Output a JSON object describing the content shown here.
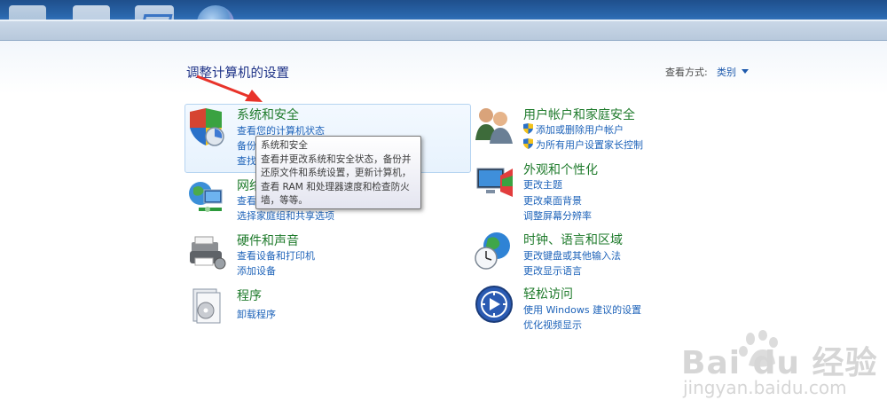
{
  "page": {
    "title": "调整计算机的设置",
    "view_by_label": "查看方式:",
    "view_by_value": "类别"
  },
  "categories": {
    "system_security": {
      "title": "系统和安全",
      "links": [
        "查看您的计算机状态",
        "备份",
        "查找"
      ]
    },
    "network": {
      "title": "网络",
      "links": [
        "查看",
        "选择家庭组和共享选项"
      ]
    },
    "hardware_sound": {
      "title": "硬件和声音",
      "links": [
        "查看设备和打印机",
        "添加设备"
      ]
    },
    "programs": {
      "title": "程序",
      "links": [
        "卸载程序"
      ]
    },
    "user_accounts": {
      "title": "用户帐户和家庭安全",
      "links": [
        "添加或删除用户帐户",
        "为所有用户设置家长控制"
      ]
    },
    "appearance": {
      "title": "外观和个性化",
      "links": [
        "更改主题",
        "更改桌面背景",
        "调整屏幕分辨率"
      ]
    },
    "clock_region": {
      "title": "时钟、语言和区域",
      "links": [
        "更改键盘或其他输入法",
        "更改显示语言"
      ]
    },
    "ease_access": {
      "title": "轻松访问",
      "links": [
        "使用 Windows 建议的设置",
        "优化视频显示"
      ]
    }
  },
  "tooltip": {
    "lines": [
      "系统和安全",
      "查看并更改系统和安全状态，备份并",
      "还原文件和系统设置，更新计算机，",
      "查看 RAM 和处理器速度和检查防火",
      "墙，等等。"
    ]
  },
  "watermark": {
    "brand": "Bai du 经验",
    "url": "jingyan.baidu.com"
  },
  "colors": {
    "category_title": "#1f7b2c",
    "link": "#1e63b9",
    "page_title": "#1e3287",
    "annotation_arrow": "#e8332a"
  }
}
